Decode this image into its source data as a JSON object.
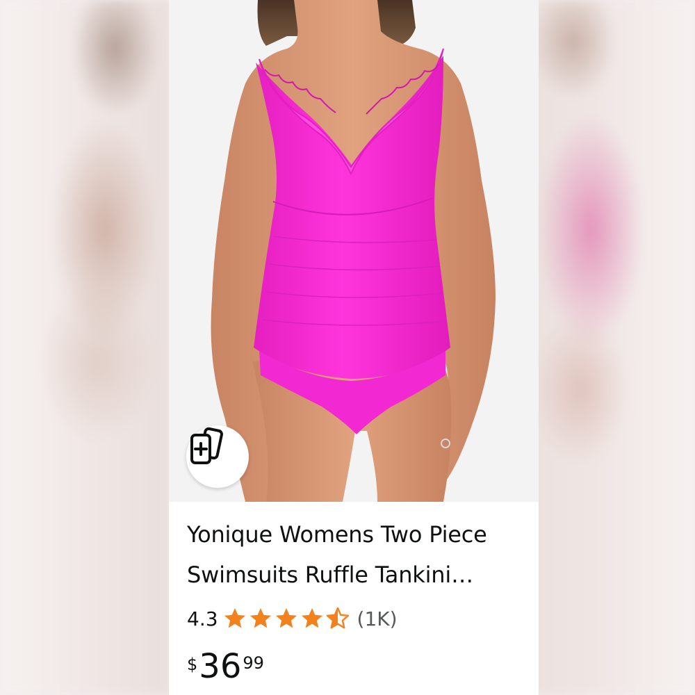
{
  "product": {
    "title": "Yonique Womens Two Piece Swimsuits Ruffle Tankini Bathing Suits Tummy Control Swimwear",
    "rating": "4.3",
    "rating_value": 4.3,
    "stars_max": 5,
    "review_count": "(1K)",
    "price": {
      "symbol": "$",
      "whole": "36",
      "fraction": "99"
    },
    "image_alt": "Woman wearing pink ruffle tankini swimsuit",
    "compare_icon": "add-to-compare-cards-icon"
  },
  "colors": {
    "star": "#f3811c",
    "swimsuit": "#ff2fd8",
    "text": "#0f1111",
    "muted": "#565959"
  }
}
